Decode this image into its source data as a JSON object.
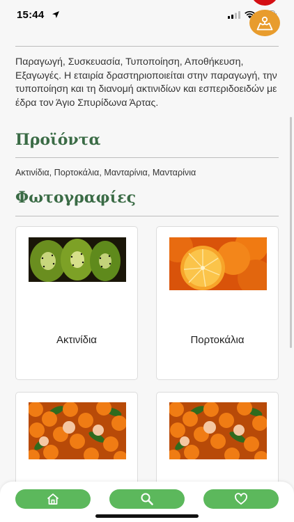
{
  "status_bar": {
    "time": "15:44"
  },
  "description": "Παραγωγή, Συσκευασία, Τυποποίηση, Αποθήκευση, Εξαγωγές. Η εταιρία δραστηριοποιείται στην παραγωγή, την τυποποίηση και τη διανομή ακτινιδίων και εσπεριδοειδών με έδρα τον Άγιο Σπυρίδωνα Άρτας.",
  "products": {
    "title": "Προϊόντα",
    "list": "Ακτινίδια, Πορτοκάλια, Μανταρίνια, Μανταρίνια"
  },
  "photos": {
    "title": "Φωτογραφίες",
    "cards": [
      {
        "caption": "Ακτινίδια",
        "image": "kiwi-slices"
      },
      {
        "caption": "Πορτοκάλια",
        "image": "orange-halves"
      },
      {
        "caption": "",
        "image": "mandarin-pile"
      },
      {
        "caption": "",
        "image": "mandarin-pile"
      }
    ]
  },
  "tabbar": {
    "items": [
      "home-icon",
      "search-icon",
      "heart-icon"
    ]
  },
  "colors": {
    "accent": "#3a6b45",
    "tab": "#5cb85c",
    "avatar": "#e89c2d",
    "badge": "#d40f14"
  }
}
